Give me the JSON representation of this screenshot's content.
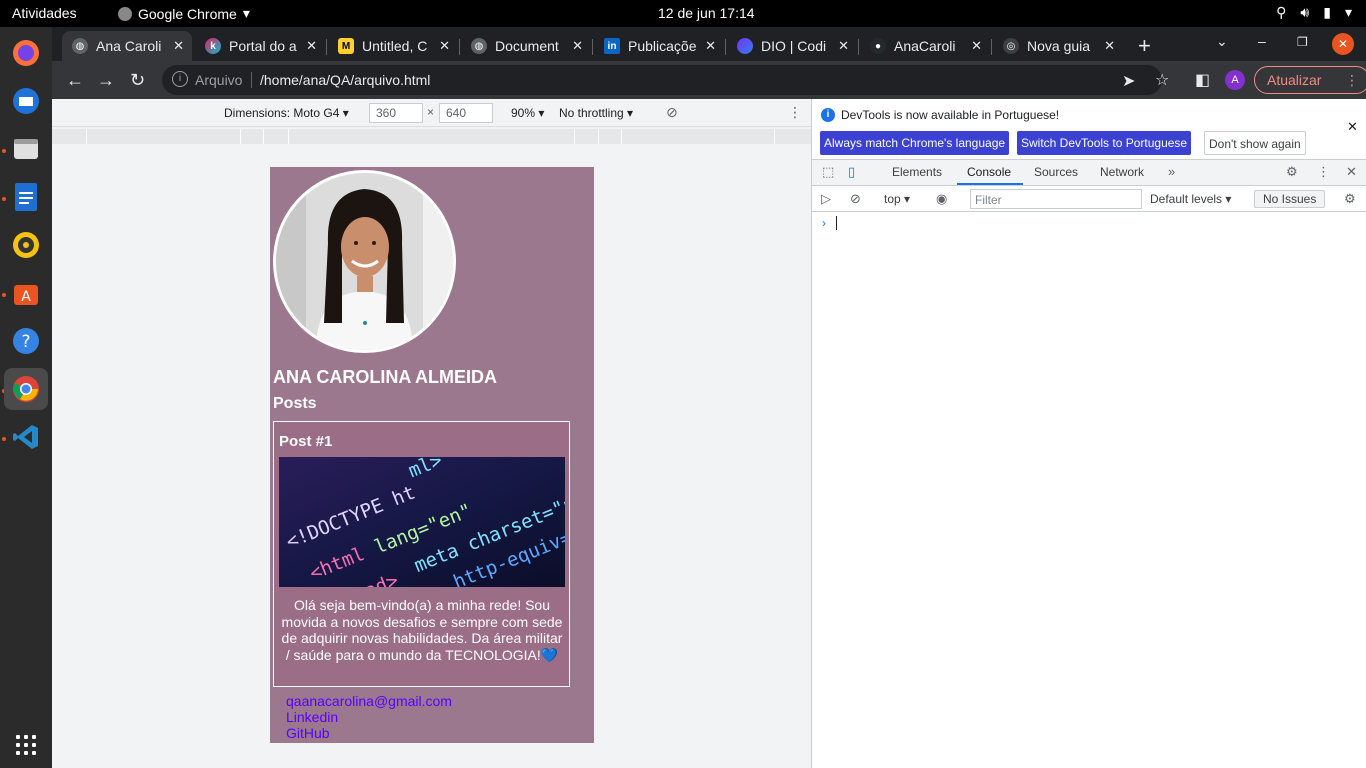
{
  "topbar": {
    "activities": "Atividades",
    "app_name": "Google Chrome",
    "clock": "12 de jun  17:14"
  },
  "tabs": [
    {
      "label": "Ana Caroli",
      "favicon": "globe-icon",
      "active": true
    },
    {
      "label": "Portal do a",
      "favicon": "kenzie-icon"
    },
    {
      "label": "Untitled, C",
      "favicon": "miro-icon"
    },
    {
      "label": "Document",
      "favicon": "globe-icon"
    },
    {
      "label": "Publicaçõe",
      "favicon": "linkedin-icon"
    },
    {
      "label": "DIO | Codi",
      "favicon": "dio-icon"
    },
    {
      "label": "AnaCaroli",
      "favicon": "github-icon"
    },
    {
      "label": "Nova guia",
      "favicon": "chrome-icon"
    }
  ],
  "omnibox": {
    "scheme_label": "Arquivo",
    "url": "/home/ana/QA/arquivo.html"
  },
  "profile_button": {
    "letter": "A"
  },
  "update_button": {
    "label": "Atualizar"
  },
  "device_toolbar": {
    "device": "Dimensions: Moto G4 ▾",
    "width": "360",
    "height": "640",
    "times": "×",
    "zoom": "90% ▾",
    "throttling": "No throttling ▾"
  },
  "page": {
    "name": "ANA CAROLINA ALMEIDA",
    "posts_heading": "Posts",
    "post": {
      "title": "Post #1",
      "image_alt": "<!DOCTYPE html> code on screen",
      "text": "Olá seja bem-vindo(a) a minha rede! Sou movida a novos desafios e sempre com sede de adquirir novas habilidades. Da área militar / saúde para o mundo da TECNOLOGIA!💙"
    },
    "links": {
      "email": "qaanacarolina@gmail.com",
      "linkedin": "Linkedin",
      "github": "GitHub"
    }
  },
  "devtools": {
    "info_message": "DevTools is now available in Portuguese!",
    "btn_match": "Always match Chrome's language",
    "btn_switch": "Switch DevTools to Portuguese",
    "btn_dismiss": "Don't show again",
    "tabs": [
      "Elements",
      "Console",
      "Sources",
      "Network"
    ],
    "context": "top ▾",
    "filter_placeholder": "Filter",
    "levels": "Default levels ▾",
    "issues": "No Issues",
    "prompt": "›"
  },
  "colors": {
    "page_bg": "#9c788e",
    "card_bg": "#9b6d86",
    "link": "#5a00ff",
    "accent": "#3b41d1"
  }
}
